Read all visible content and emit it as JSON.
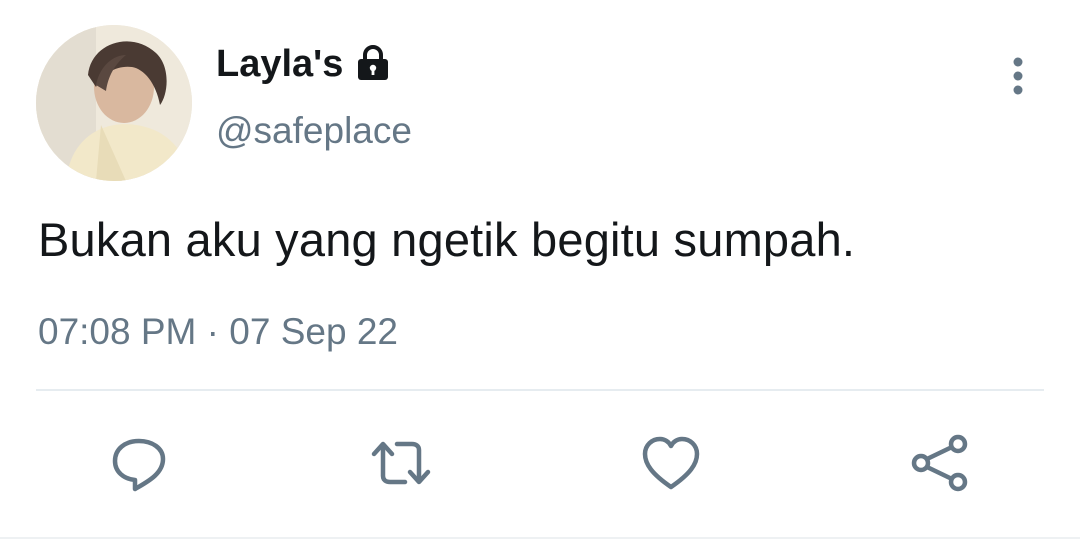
{
  "tweet": {
    "display_name": "Layla's",
    "handle": "@safeplace",
    "text": "Bukan aku yang ngetik begitu sumpah.",
    "time": "07:08 PM",
    "separator": "·",
    "date": "07 Sep 22"
  },
  "icons": {
    "protected": "lock-icon",
    "menu": "more-vertical-icon",
    "reply": "reply-icon",
    "retweet": "retweet-icon",
    "like": "heart-icon",
    "share": "share-icon"
  },
  "colors": {
    "text": "#14171a",
    "secondary": "#657786",
    "divider": "#e6ecf0"
  }
}
